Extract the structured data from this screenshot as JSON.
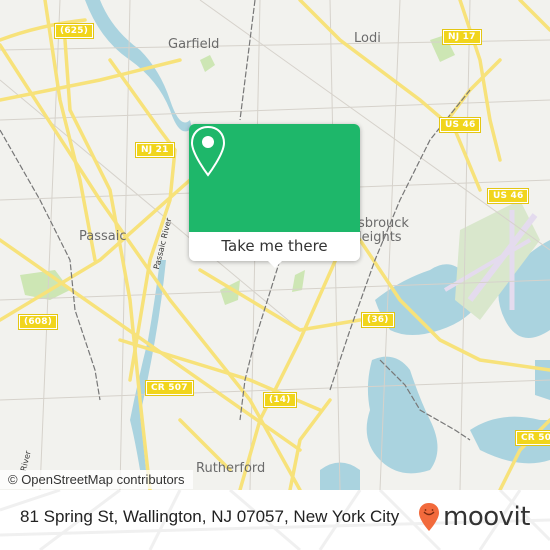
{
  "map": {
    "places": [
      {
        "id": "garfield",
        "label": "Garfield"
      },
      {
        "id": "lodi",
        "label": "Lodi"
      },
      {
        "id": "passaic",
        "label": "Passaic"
      },
      {
        "id": "hasbrouck",
        "label": "sbrouck\nleights"
      },
      {
        "id": "rutherford",
        "label": "Rutherford"
      }
    ],
    "water_labels": [
      {
        "id": "passaic-river",
        "label": "Passaic River"
      },
      {
        "id": "river-left",
        "label": "River"
      }
    ],
    "shields": [
      {
        "id": "r625",
        "label": "(625)"
      },
      {
        "id": "nj17",
        "label": "NJ 17"
      },
      {
        "id": "nj21",
        "label": "NJ 21"
      },
      {
        "id": "us46a",
        "label": "US 46"
      },
      {
        "id": "us46b",
        "label": "US 46"
      },
      {
        "id": "r608",
        "label": "(608)"
      },
      {
        "id": "r36",
        "label": "(36)"
      },
      {
        "id": "cr507",
        "label": "CR 507"
      },
      {
        "id": "r14",
        "label": "(14)"
      },
      {
        "id": "cr50x",
        "label": "CR 50"
      }
    ],
    "attribution": "© OpenStreetMap contributors",
    "colors": {
      "land": "#f2f2ee",
      "water": "#aad3df",
      "road": "#f7e27a",
      "park": "#cde6b4",
      "rail": "#777777",
      "airport": "#e4dbee"
    }
  },
  "popup": {
    "button_label": "Take me there",
    "icon": "map-pin-icon",
    "color": "#1eb76a"
  },
  "footer": {
    "address": "81 Spring St, Wallington, NJ 07057, New York City",
    "brand": "moovit",
    "brand_icon": "moovit-smiley-pin-icon",
    "brand_color": "#f26a3c"
  }
}
